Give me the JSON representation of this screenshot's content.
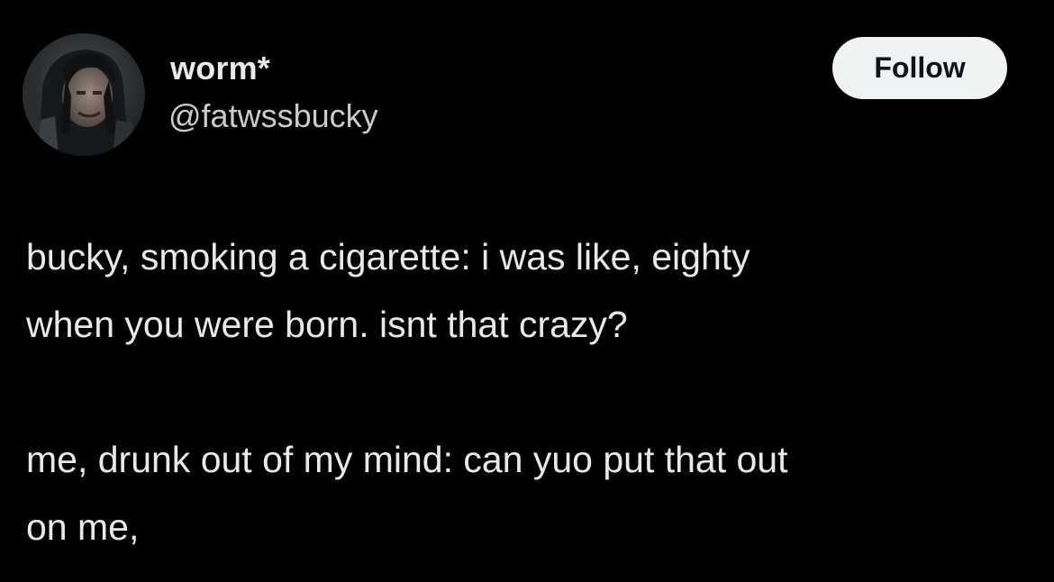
{
  "author": {
    "display_name": "worm*",
    "handle": "@fatwssbucky",
    "avatar_icon": "profile-photo"
  },
  "follow_label": "Follow",
  "tweet": {
    "paragraph_1": "bucky, smoking a cigarette: i was like, eighty\nwhen you were born. isnt that crazy?",
    "paragraph_2": "me, drunk out of my mind: can yuo put that out\non me,"
  },
  "colors": {
    "background": "#000000",
    "text": "#e7e9ea",
    "handle_text": "#c9ccce",
    "button_bg": "#eff3f4",
    "button_text": "#0f1419"
  }
}
